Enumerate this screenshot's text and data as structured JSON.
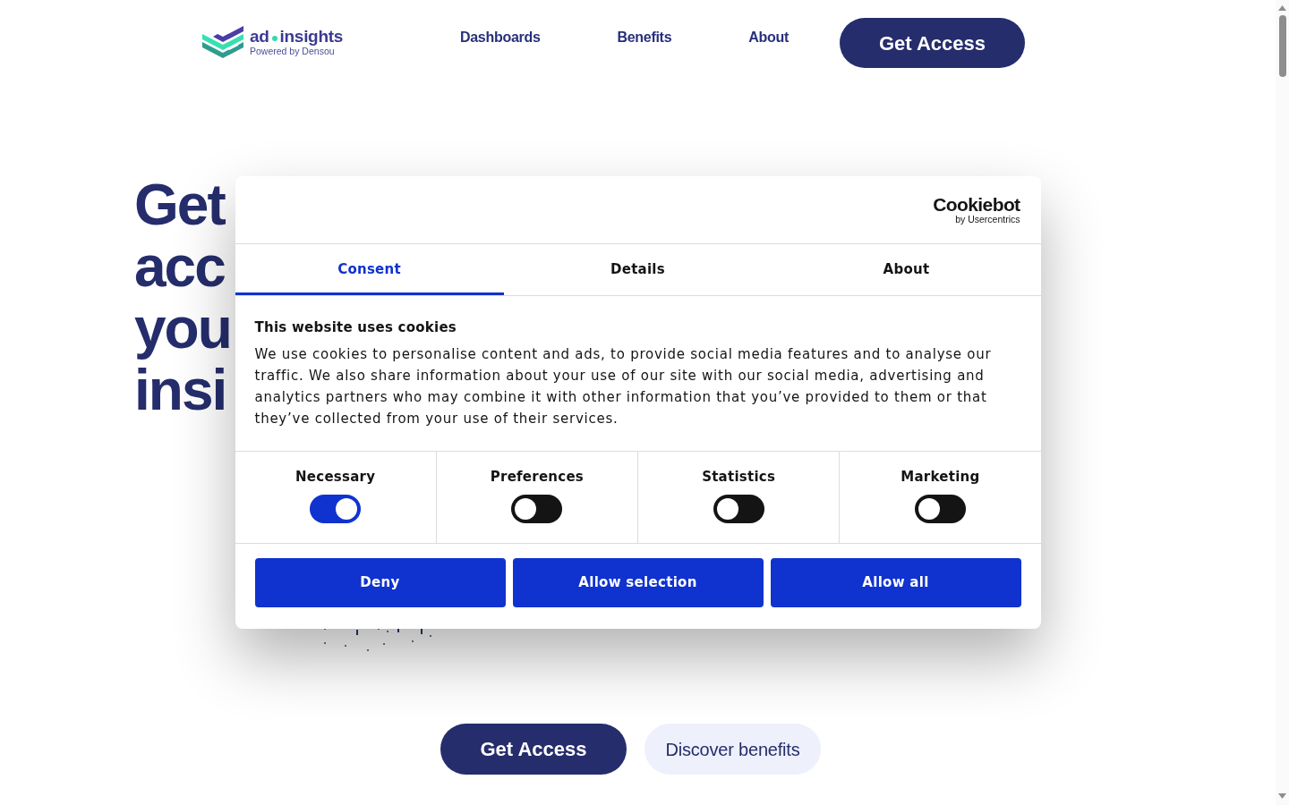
{
  "header": {
    "logo": {
      "name_start": "ad",
      "name_end": "insights",
      "tagline": "Powered by Densou"
    },
    "nav_links": [
      "Dashboards",
      "Benefits",
      "About"
    ],
    "cta_button": "Get Access"
  },
  "hero": {
    "headline_fragments": [
      "Get",
      "acc",
      "you",
      "insi"
    ],
    "buttons": [
      {
        "label": "Get Access",
        "kind": "primary"
      },
      {
        "label": "Discover benefits",
        "kind": "secondary"
      }
    ]
  },
  "cookie_dialog": {
    "brand": {
      "name": "Cookiebot",
      "byline": "by Usercentrics"
    },
    "tabs": [
      {
        "label": "Consent",
        "selected": true
      },
      {
        "label": "Details",
        "selected": false
      },
      {
        "label": "About",
        "selected": false
      }
    ],
    "title": "This website uses cookies",
    "body": "We use cookies to personalise content and ads, to provide social media features and to analyse our traffic. We also share information about your use of our site with our social media, advertising and analytics partners who may combine it with other information that you’ve provided to them or that they’ve collected from your use of their services.",
    "categories": [
      {
        "label": "Necessary",
        "checked": true
      },
      {
        "label": "Preferences",
        "checked": false
      },
      {
        "label": "Statistics",
        "checked": false
      },
      {
        "label": "Marketing",
        "checked": false
      }
    ],
    "buttons": [
      "Deny",
      "Allow selection",
      "Allow all"
    ]
  }
}
